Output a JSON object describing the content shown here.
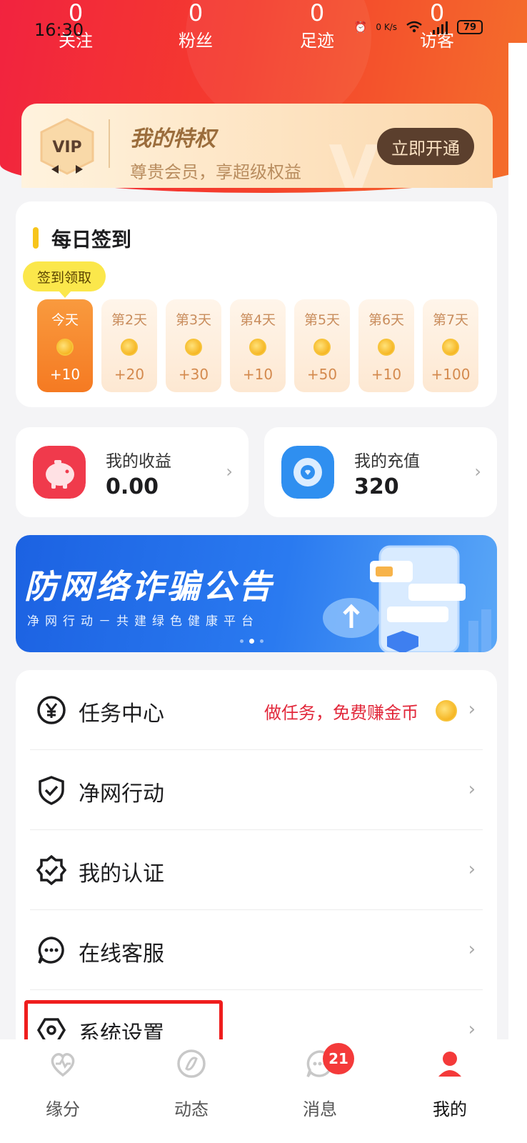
{
  "status_bar": {
    "time": "16:30",
    "network_speed": "0 K/s",
    "battery": "79"
  },
  "stats": [
    {
      "value": "0",
      "label": "关注"
    },
    {
      "value": "0",
      "label": "粉丝"
    },
    {
      "value": "0",
      "label": "足迹"
    },
    {
      "value": "0",
      "label": "访客"
    }
  ],
  "vip": {
    "badge": "VIP",
    "title": "我的特权",
    "subtitle": "尊贵会员，享超级权益",
    "button": "立即开通"
  },
  "checkin": {
    "title": "每日签到",
    "tag": "签到领取",
    "days": [
      {
        "label": "今天",
        "reward": "+10"
      },
      {
        "label": "第2天",
        "reward": "+20"
      },
      {
        "label": "第3天",
        "reward": "+30"
      },
      {
        "label": "第4天",
        "reward": "+10"
      },
      {
        "label": "第5天",
        "reward": "+50"
      },
      {
        "label": "第6天",
        "reward": "+10"
      },
      {
        "label": "第7天",
        "reward": "+100"
      }
    ]
  },
  "earnings": {
    "label": "我的收益",
    "value": "0.00"
  },
  "recharge": {
    "label": "我的充值",
    "value": "320"
  },
  "banner": {
    "title": "防网络诈骗公告",
    "subtitle": "净网行动－共建绿色健康平台"
  },
  "menu": {
    "task_center": "任务中心",
    "task_promo": "做任务，免费赚金币",
    "clean_net": "净网行动",
    "my_auth": "我的认证",
    "support": "在线客服",
    "settings": "系统设置"
  },
  "tabs": {
    "match": "缘分",
    "feed": "动态",
    "messages": "消息",
    "messages_badge": "21",
    "mine": "我的"
  },
  "colors": {
    "accent": "#f43c2d",
    "highlight_box": "#ef1d1d",
    "coin": "#f2a400"
  }
}
